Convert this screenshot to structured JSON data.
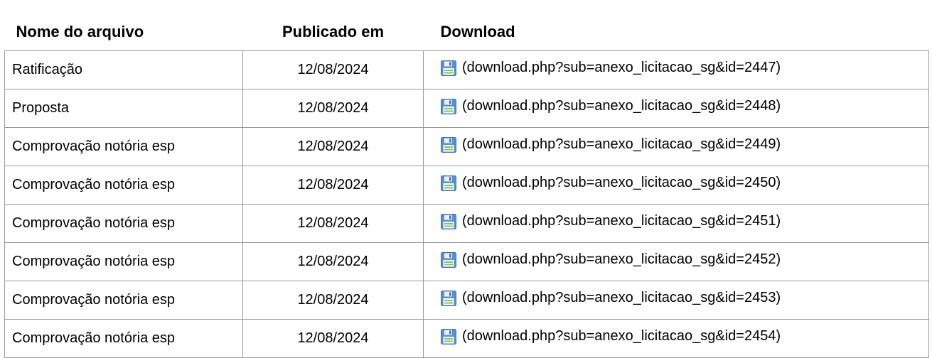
{
  "table": {
    "headers": {
      "name": "Nome do arquivo",
      "date": "Publicado em",
      "download": "Download"
    },
    "rows": [
      {
        "name": "Ratificação",
        "date": "12/08/2024",
        "link": "(download.php?sub=anexo_licitacao_sg&id=2447)",
        "icon": "save-icon"
      },
      {
        "name": "Proposta",
        "date": "12/08/2024",
        "link": "(download.php?sub=anexo_licitacao_sg&id=2448)",
        "icon": "save-icon"
      },
      {
        "name": "Comprovação notória esp",
        "date": "12/08/2024",
        "link": "(download.php?sub=anexo_licitacao_sg&id=2449)",
        "icon": "save-icon"
      },
      {
        "name": "Comprovação notória esp",
        "date": "12/08/2024",
        "link": "(download.php?sub=anexo_licitacao_sg&id=2450)",
        "icon": "save-icon"
      },
      {
        "name": "Comprovação notória esp",
        "date": "12/08/2024",
        "link": "(download.php?sub=anexo_licitacao_sg&id=2451)",
        "icon": "save-icon"
      },
      {
        "name": "Comprovação notória esp",
        "date": "12/08/2024",
        "link": "(download.php?sub=anexo_licitacao_sg&id=2452)",
        "icon": "save-icon"
      },
      {
        "name": "Comprovação notória esp",
        "date": "12/08/2024",
        "link": "(download.php?sub=anexo_licitacao_sg&id=2453)",
        "icon": "save-icon"
      },
      {
        "name": "Comprovação notória esp",
        "date": "12/08/2024",
        "link": "(download.php?sub=anexo_licitacao_sg&id=2454)",
        "icon": "save-icon"
      }
    ]
  },
  "colors": {
    "border": "#9a9a9a",
    "icon_blue": "#5a8fd0",
    "icon_green": "#7cc46b"
  }
}
